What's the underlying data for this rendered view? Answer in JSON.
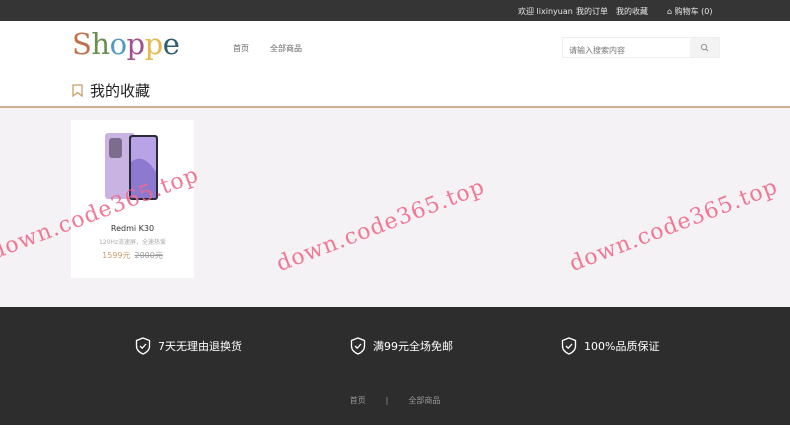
{
  "topbar": {
    "welcome": "欢迎 lixinyuan",
    "orders": "我的订单",
    "favorites": "我的收藏",
    "cart": "购物车 (0)"
  },
  "header": {
    "logo": "Shoppe",
    "nav": [
      "首页",
      "全部商品"
    ],
    "search_placeholder": "请输入搜索内容"
  },
  "page": {
    "title": "我的收藏"
  },
  "products": [
    {
      "name": "Redmi K30",
      "desc": "120Hz流速屏，全速热爱",
      "price": "1599元",
      "original_price": "2000元"
    }
  ],
  "footer": {
    "features": [
      "7天无理由退换货",
      "满99元全场免邮",
      "100%品质保证"
    ],
    "links": [
      "首页",
      "全部商品"
    ],
    "separator": "|"
  },
  "watermark": "down.code365.top",
  "colors": {
    "topbar": "#353535",
    "accent": "#c8a06b",
    "footer": "#2e2d2d",
    "content_bg": "#f4f2f4"
  }
}
